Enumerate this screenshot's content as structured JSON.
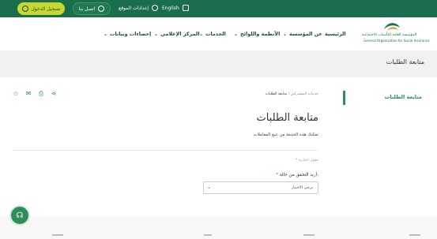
{
  "topbar": {
    "login_label": "تسجيل الدخول",
    "contact_label": "اتصل بنا",
    "settings_label": "إعدادات الموقع",
    "language_label": "English"
  },
  "logo": {
    "arabic": "المؤسسة العامة للتأمينات الاجتماعية",
    "english": "General Organization for Social Insurance"
  },
  "nav": {
    "items": [
      {
        "label": "الرئيسية"
      },
      {
        "label": "عن المؤسسة"
      },
      {
        "label": "الأنظمة واللوائح"
      },
      {
        "label": "الخدمات"
      },
      {
        "label": "المركز الإعلامي"
      },
      {
        "label": "إحصاءات وبيانات"
      }
    ]
  },
  "banner": {
    "title": "متابعة الطلبات"
  },
  "breadcrumb": {
    "parent": "خدمات المشتركين",
    "current": "متابعة الطلبات"
  },
  "side_tab": {
    "label": "متابعة الطلبات"
  },
  "main": {
    "title": "متابعة الطلبات",
    "description": "تمكنك هذه الخدمة من تتبع المعاملات",
    "required_note": "* حقول اجبارية",
    "field_label": "أريد التحقق من حالة:",
    "select_value": "يرجى الاختيار"
  },
  "colors": {
    "primary": "#1b6e4b",
    "accent": "#c7d92f",
    "link": "#2f8d5a"
  }
}
